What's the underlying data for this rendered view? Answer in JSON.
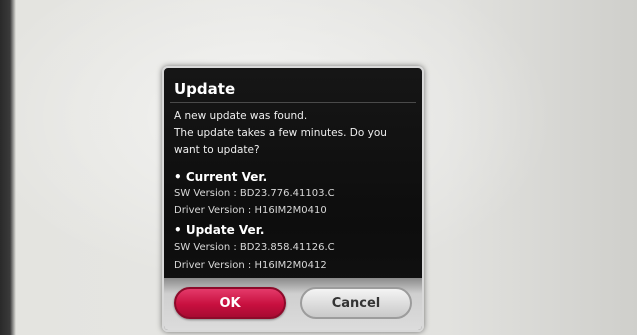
{
  "dialog": {
    "title": "Update",
    "message_lines": [
      "A new update was found.",
      "The update takes a few minutes. Do you",
      "want to update?"
    ],
    "current": {
      "heading": "• Current Ver.",
      "sw_version": "SW Version : BD23.776.41103.C",
      "driver_version": "Driver Version : H16IM2M0410"
    },
    "update": {
      "heading": "• Update Ver.",
      "sw_version": "SW Version : BD23.858.41126.C",
      "driver_version": "Driver Version : H16IM2M0412"
    },
    "buttons": {
      "ok_label": "OK",
      "cancel_label": "Cancel"
    }
  },
  "colors": {
    "ok_button": "#c8103f",
    "dialog_background": "#111111"
  }
}
